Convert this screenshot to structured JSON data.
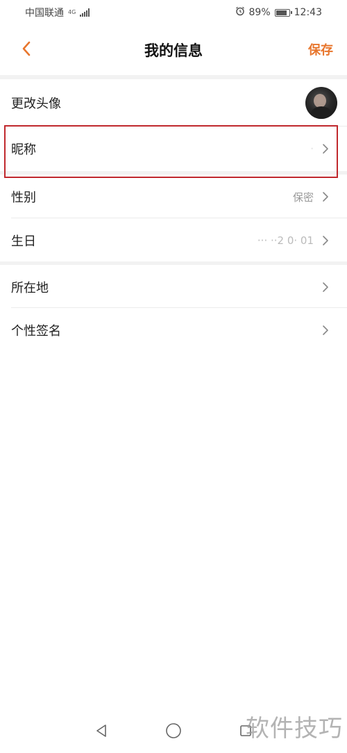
{
  "status_bar": {
    "carrier": "中国联通",
    "network_type_top": "4G",
    "network_type_bottom": "4G",
    "alarm_icon": "alarm-clock-icon",
    "battery_percent_text": "89%",
    "battery_level": 0.89,
    "time": "12:43"
  },
  "header": {
    "back_icon": "chevron-left-icon",
    "title": "我的信息",
    "save_label": "保存",
    "accent_color": "#e8762d"
  },
  "profile": {
    "rows": [
      {
        "label": "更改头像",
        "value": ""
      },
      {
        "label": "昵称",
        "value": "·"
      },
      {
        "label": "性别",
        "value": "保密"
      },
      {
        "label": "生日",
        "value": "··· ··2 0·  01"
      },
      {
        "label": "所在地",
        "value": ""
      },
      {
        "label": "个性签名",
        "value": ""
      }
    ]
  },
  "highlight_color": "#c0282d",
  "nav_bar": {
    "back_icon": "triangle-back-icon",
    "home_icon": "circle-home-icon",
    "recents_icon": "square-recents-icon"
  },
  "watermark": "软件技巧"
}
